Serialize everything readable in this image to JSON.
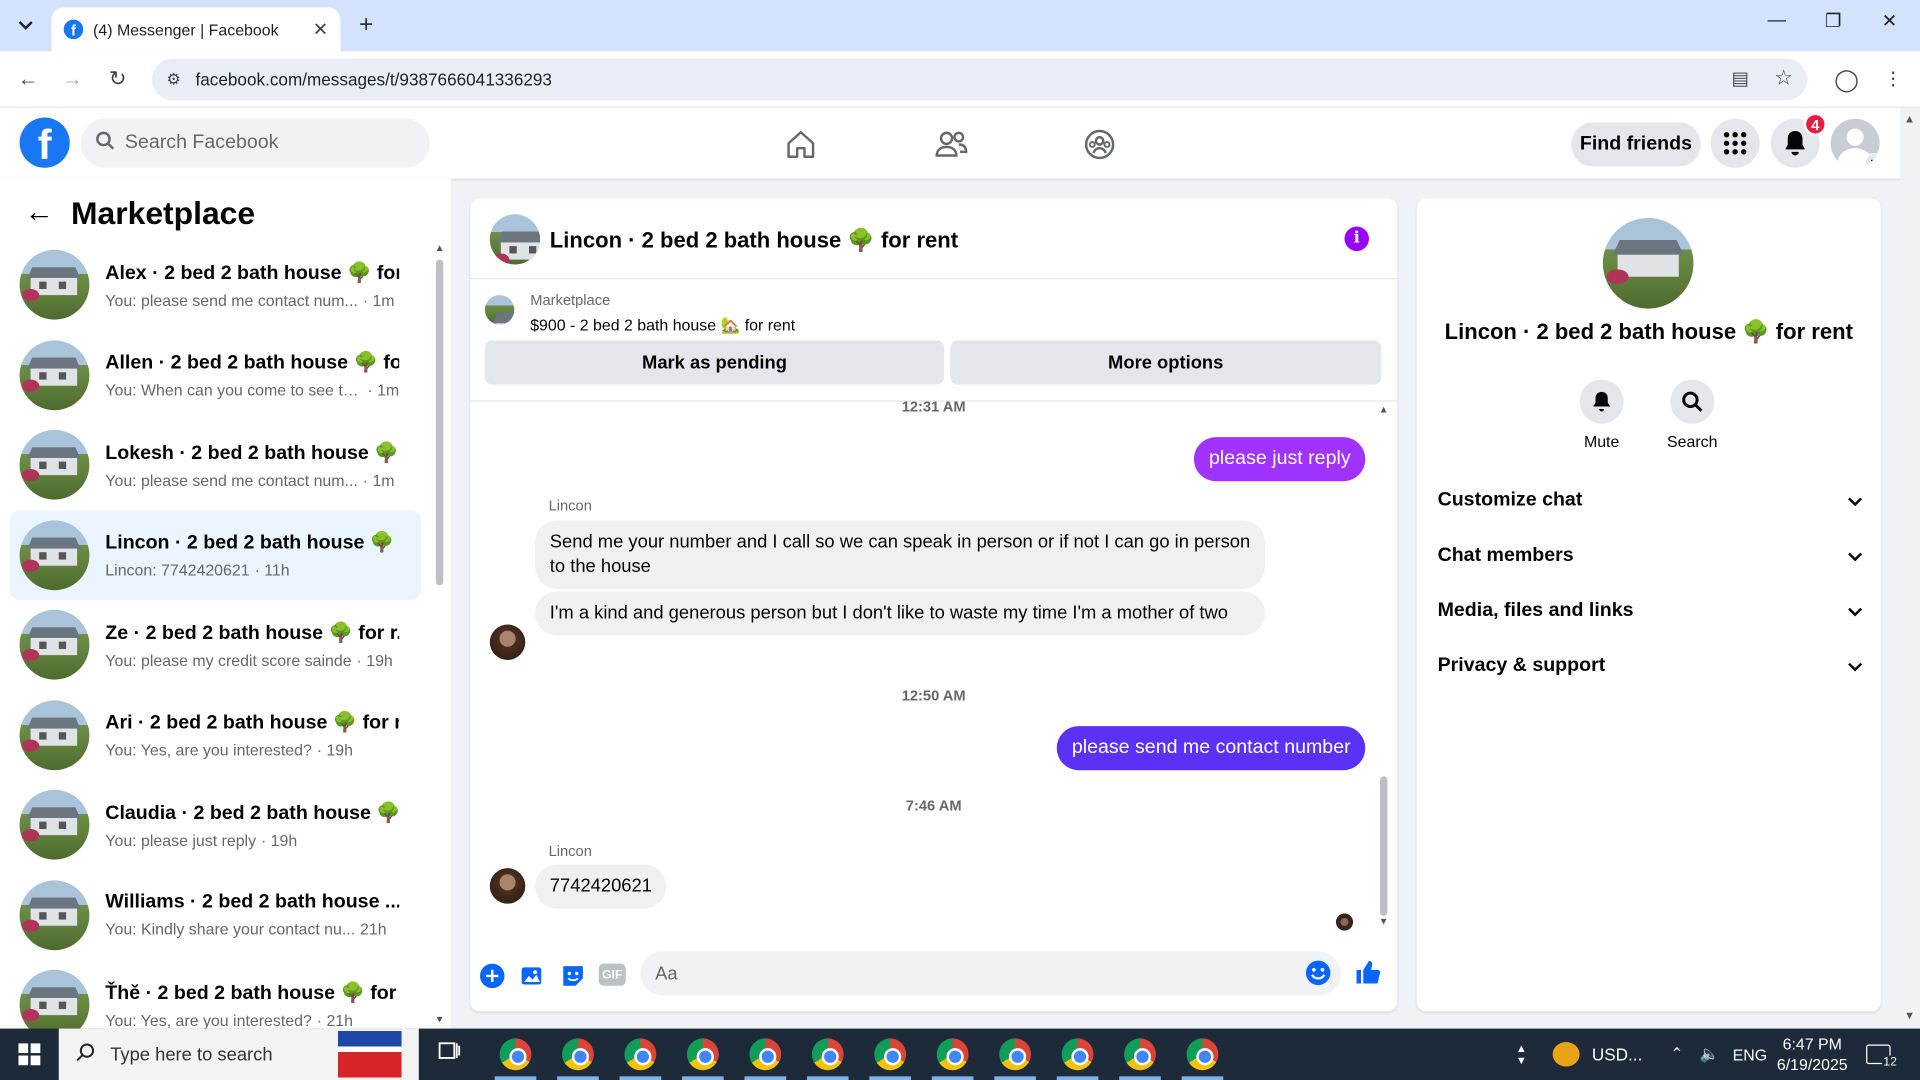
{
  "browser": {
    "tab_title": "(4) Messenger | Facebook",
    "url": "facebook.com/messages/t/9387666041336293",
    "new_tab": "+",
    "close_tab": "✕"
  },
  "facebook": {
    "search_placeholder": "Search Facebook",
    "find_friends": "Find friends",
    "notification_count": "4"
  },
  "left": {
    "title": "Marketplace",
    "conversations": [
      {
        "name": "Alex · 2 bed 2 bath house 🌳 for...",
        "preview": "You: please send me contact num...",
        "time": "· 1m"
      },
      {
        "name": "Allen · 2 bed 2 bath house 🌳 fo...",
        "preview": "You: When can you come to see th...",
        "time": "· 1m"
      },
      {
        "name": "Lokesh · 2 bed 2 bath house 🌳 ...",
        "preview": "You: please send me contact num...",
        "time": "· 1m"
      },
      {
        "name": "Lincon · 2 bed 2 bath house 🌳 f...",
        "preview": "Lincon: 7742420621",
        "time": "· 11h"
      },
      {
        "name": "Ze · 2 bed 2 bath house 🌳 for r...",
        "preview": "You: please my credit score sainde",
        "time": "· 19h"
      },
      {
        "name": "Ari · 2 bed 2 bath house 🌳 for r...",
        "preview": "You: Yes, are you interested?",
        "time": "· 19h"
      },
      {
        "name": "Claudia · 2 bed 2 bath house 🌳 ...",
        "preview": "You: please just reply",
        "time": "· 19h"
      },
      {
        "name": "Williams · 2 bed 2 bath house ...",
        "preview": "You: Kindly share your contact nu...",
        "time": "21h"
      },
      {
        "name": "Ťhě · 2 bed 2 bath house 🌳 for ...",
        "preview": "You: Yes, are you interested?",
        "time": "· 21h"
      }
    ]
  },
  "chat": {
    "title": "Lincon · 2 bed 2 bath house 🌳 for rent",
    "marketplace_label": "Marketplace",
    "listing": "$900 - 2 bed 2 bath house 🏡 for rent",
    "mark_pending": "Mark as pending",
    "more_options": "More options",
    "messages": {
      "time1": "12:31 AM",
      "out1": "please just reply",
      "sender1": "Lincon",
      "in1": "Send me your number and I call so we can speak in person or if not I can go in person to the house",
      "in2": "I'm a kind and generous person but I don't like to waste my time I'm a mother of two",
      "time2": "12:50 AM",
      "out2": "please send me contact number",
      "time3": "7:46 AM",
      "sender2": "Lincon",
      "in3": "7742420621"
    },
    "composer_placeholder": "Aa",
    "gif_label": "GIF",
    "colors": {
      "out1": "#a033ff",
      "out2": "#5b32f5",
      "accent": "#9900ff"
    }
  },
  "info_panel": {
    "name": "Lincon · 2 bed 2 bath house 🌳 for rent",
    "mute": "Mute",
    "search": "Search",
    "rows": [
      "Customize chat",
      "Chat members",
      "Media, files and links",
      "Privacy & support"
    ]
  },
  "taskbar": {
    "search_placeholder": "Type here to search",
    "currency": "USD...",
    "lang": "ENG",
    "time": "6:47 PM",
    "date": "6/19/2025",
    "notif": "12"
  }
}
